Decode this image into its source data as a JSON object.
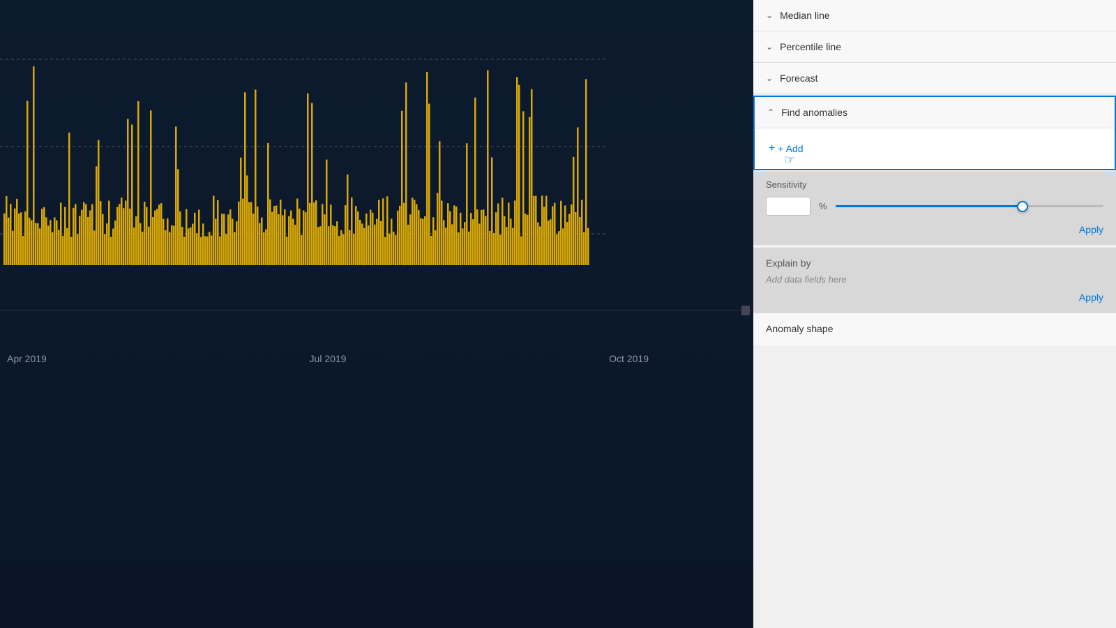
{
  "chart": {
    "x_labels": [
      "Apr 2019",
      "Jul 2019",
      "Oct 2019"
    ],
    "background_color": "#0d1b2e",
    "bar_color": "#f0b800"
  },
  "right_panel": {
    "sections": [
      {
        "id": "median-line",
        "label": "Median line",
        "collapsed": true,
        "chevron": "chevron-down"
      },
      {
        "id": "percentile-line",
        "label": "Percentile line",
        "collapsed": true,
        "chevron": "chevron-down"
      },
      {
        "id": "forecast",
        "label": "Forecast",
        "collapsed": true,
        "chevron": "chevron-down"
      }
    ],
    "find_anomalies": {
      "label": "Find anomalies",
      "expanded": true,
      "add_button_label": "+ Add",
      "sensitivity": {
        "label": "Sensitivity",
        "value": "70",
        "unit": "%",
        "slider_percent": 70,
        "apply_label": "Apply"
      },
      "explain_by": {
        "title": "Explain by",
        "placeholder": "Add data fields here",
        "apply_label": "Apply"
      }
    },
    "anomaly_shape": {
      "label": "Anomaly shape"
    }
  }
}
